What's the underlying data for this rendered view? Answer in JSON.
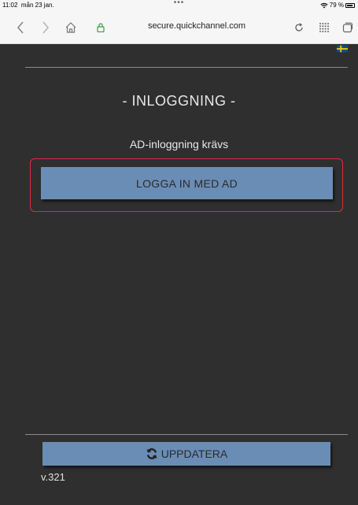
{
  "status_bar": {
    "time": "11:02",
    "date": "mån 23 jan.",
    "dots": "•••",
    "battery": "79 %"
  },
  "browser": {
    "url": "secure.quickchannel.com",
    "icons": [
      "back-icon",
      "forward-icon",
      "home-icon",
      "lock-icon",
      "reload-icon",
      "grid-icon",
      "tabs-icon"
    ]
  },
  "page": {
    "flag": "swedish-flag-icon",
    "title": "- INLOGGNING -",
    "ad_required": "AD-inloggning krävs",
    "login_button": "LOGGA IN MED AD",
    "refresh_button": "UPPDATERA",
    "refresh_icon": "refresh-icon",
    "version": "v.321"
  },
  "colors": {
    "background": "#2f2f2f",
    "button": "#6a8db5",
    "highlight": "#e0293a",
    "flag_blue": "#005293",
    "flag_yellow": "#fecb00"
  }
}
